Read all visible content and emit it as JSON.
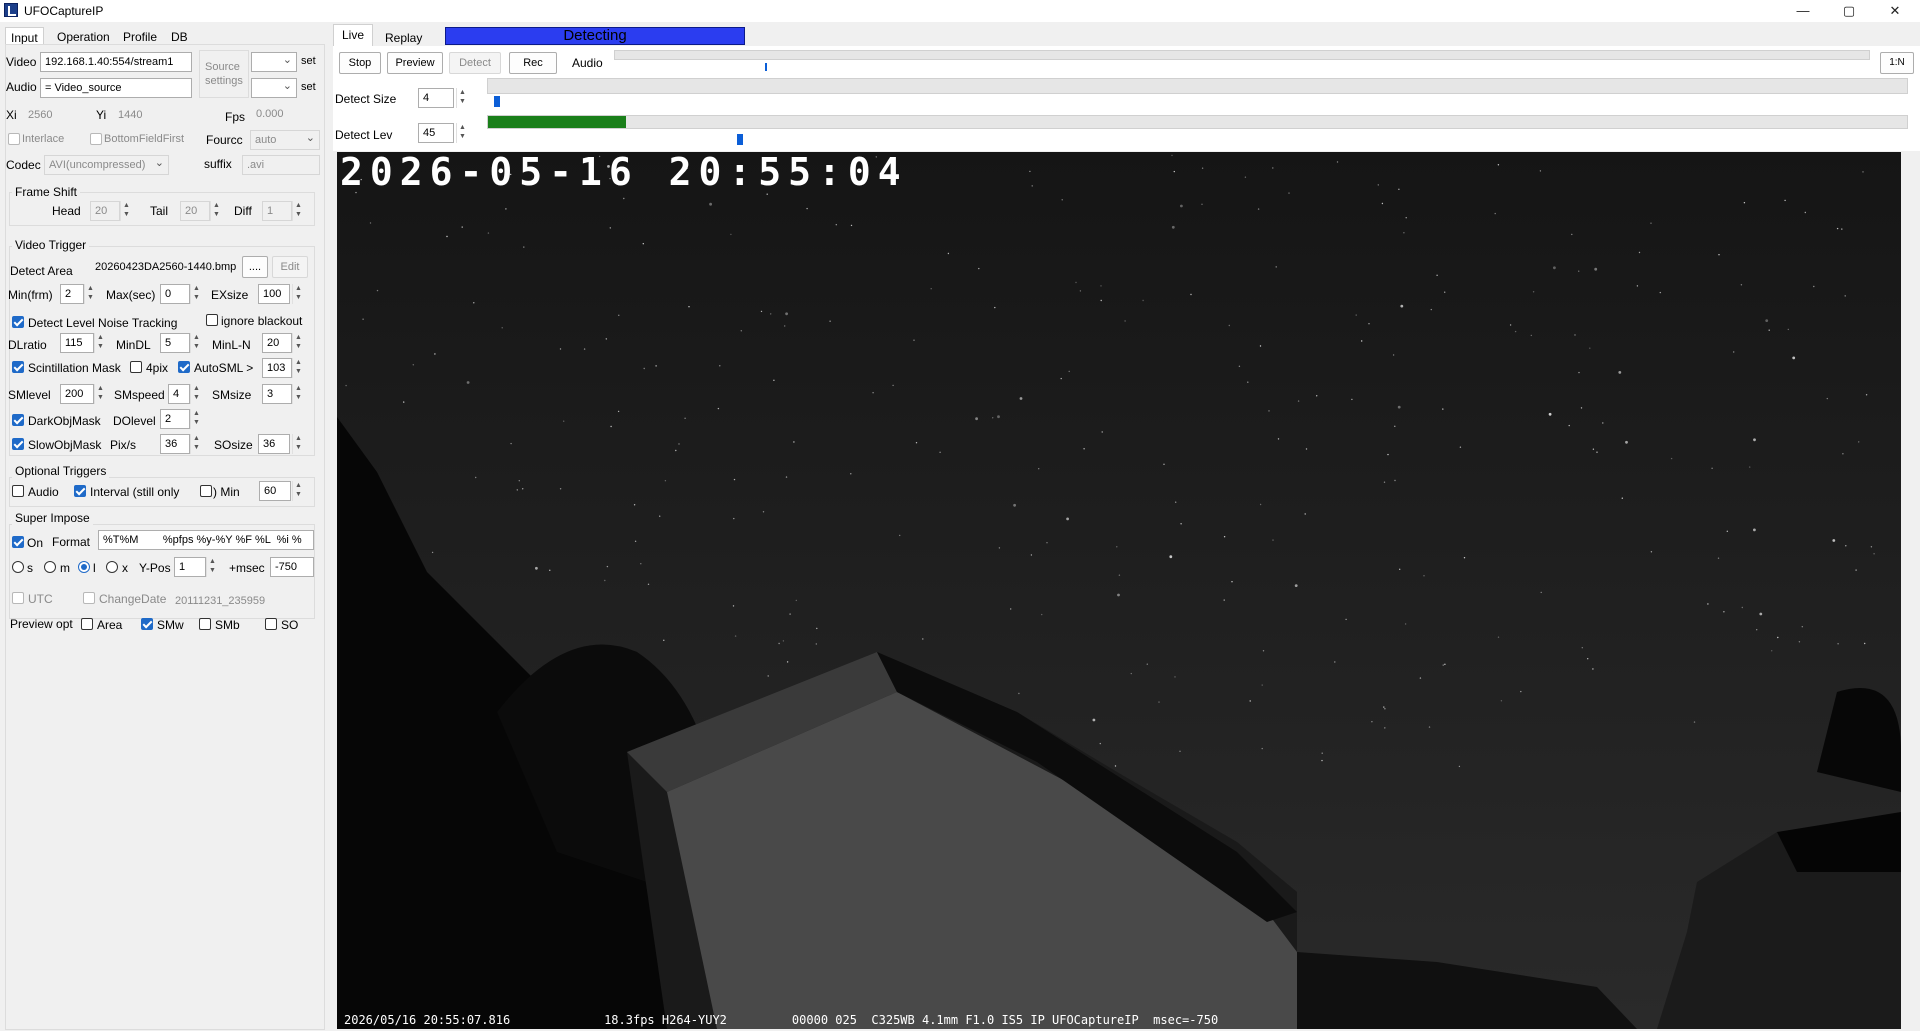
{
  "window": {
    "title": "UFOCaptureIP",
    "minimize": "—",
    "maximize": "▢",
    "close": "✕"
  },
  "tabs_left": [
    "Input",
    "Operation",
    "Profile",
    "DB"
  ],
  "tabs_main": [
    "Live",
    "Replay"
  ],
  "status": {
    "text": "Detecting",
    "color": "#2b3df0"
  },
  "toolbar": {
    "stop": "Stop",
    "preview": "Preview",
    "detect": "Detect",
    "rec": "Rec",
    "audio": "Audio",
    "ratio": "1:N"
  },
  "audio_level": 0.12,
  "detect_size": {
    "label": "Detect Size",
    "value": "4"
  },
  "detect_lev": {
    "label": "Detect Lev",
    "value": "45",
    "bar_fraction": 0.097,
    "bar_color": "#1a7f1a",
    "thumb_fraction": 0.176
  },
  "input": {
    "video_label": "Video",
    "video_value": "192.168.1.40:554/stream1",
    "audio_label": "Audio",
    "audio_value": "= Video_source",
    "source_settings": "Source\nsettings",
    "set": "set",
    "xi_label": "Xi",
    "xi_value": "2560",
    "yi_label": "Yi",
    "yi_value": "1440",
    "fps_label": "Fps",
    "fps_value": "0.000",
    "interlace": "Interlace",
    "bottom_field_first": "BottomFieldFirst",
    "fourcc_label": "Fourcc",
    "fourcc_value": "auto",
    "codec_label": "Codec",
    "codec_value": "AVI(uncompressed)",
    "suffix_label": "suffix",
    "suffix_value": ".avi"
  },
  "frame_shift": {
    "title": "Frame Shift",
    "head_label": "Head",
    "head_value": "20",
    "tail_label": "Tail",
    "tail_value": "20",
    "diff_label": "Diff",
    "diff_value": "1"
  },
  "video_trigger": {
    "title": "Video Trigger",
    "detect_area_label": "Detect Area",
    "detect_area_value": "20260423DA2560-1440.bmp",
    "browse": "....",
    "edit": "Edit",
    "minfrm_label": "Min(frm)",
    "minfrm_value": "2",
    "maxsec_label": "Max(sec)",
    "maxsec_value": "0",
    "exsize_label": "EXsize",
    "exsize_value": "100",
    "dlnt": "Detect Level Noise Tracking",
    "ignore_blackout": "ignore blackout",
    "dlratio_label": "DLratio",
    "dlratio_value": "115",
    "mindl_label": "MinDL",
    "mindl_value": "5",
    "minln_label": "MinL-N",
    "minln_value": "20",
    "scint": "Scintillation Mask",
    "fourpix": "4pix",
    "autosml": "AutoSML >",
    "autosml_value": "103",
    "smlevel_label": "SMlevel",
    "smlevel_value": "200",
    "smspeed_label": "SMspeed",
    "smspeed_value": "4",
    "smsize_label": "SMsize",
    "smsize_value": "3",
    "darkobj": "DarkObjMask",
    "dolevel_label": "DOlevel",
    "dolevel_value": "2",
    "slowobj": "SlowObjMask",
    "pixs_label": "Pix/s",
    "pixs_value": "36",
    "sosize_label": "SOsize",
    "sosize_value": "36"
  },
  "optional_triggers": {
    "title": "Optional Triggers",
    "audio": "Audio",
    "interval": "Interval (still only",
    "min_label": ") Min",
    "min_value": "60"
  },
  "super_impose": {
    "title": "Super Impose",
    "on": "On",
    "format_label": "Format",
    "format_value": "%T%M        %pfps %y-%Y %F %L  %i %",
    "s": "s",
    "m": "m",
    "l": "l",
    "x": "x",
    "ypos_label": "Y-Pos",
    "ypos_value": "1",
    "msec_label": "+msec",
    "msec_value": "-750",
    "utc": "UTC",
    "change_date": "ChangeDate",
    "change_date_value": "20111231_235959"
  },
  "preview_opt": {
    "label": "Preview opt",
    "area": "Area",
    "smw": "SMw",
    "smb": "SMb",
    "so": "SO"
  },
  "video": {
    "timestamp": "2026-05-16  20:55:04",
    "footer": "2026/05/16 20:55:07.816             18.3fps H264-YUY2         00000 025  C325WB 4.1mm F1.0 IS5 IP UFOCaptureIP  msec=-750"
  }
}
